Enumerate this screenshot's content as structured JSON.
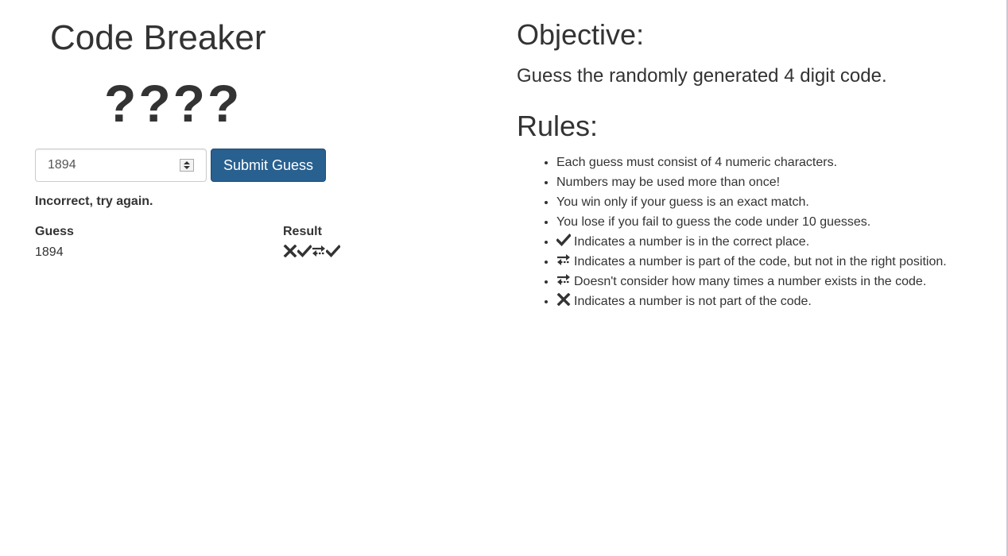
{
  "game": {
    "title": "Code Breaker",
    "code_display": "????",
    "guess_input": {
      "value": "1894"
    },
    "submit_label": "Submit Guess",
    "status_message": "Incorrect, try again.",
    "history": {
      "headers": {
        "guess": "Guess",
        "result": "Result"
      },
      "rows": [
        {
          "guess": "1894",
          "result": [
            "x-icon",
            "check-icon",
            "swap-icon",
            "check-icon"
          ]
        }
      ]
    }
  },
  "info": {
    "objective_heading": "Objective:",
    "objective_text": "Guess the randomly generated 4 digit code.",
    "rules_heading": "Rules:",
    "rules": [
      {
        "icon": "",
        "text": "Each guess must consist of 4 numeric characters."
      },
      {
        "icon": "",
        "text": "Numbers may be used more than once!"
      },
      {
        "icon": "",
        "text": "You win only if your guess is an exact match."
      },
      {
        "icon": "",
        "text": "You lose if you fail to guess the code under 10 guesses."
      },
      {
        "icon": "check-icon",
        "text": "Indicates a number is in the correct place."
      },
      {
        "icon": "swap-icon",
        "text": "Indicates a number is part of the code, but not in the right position."
      },
      {
        "icon": "swap-icon",
        "text": "Doesn't consider how many times a number exists in the code."
      },
      {
        "icon": "x-icon",
        "text": "Indicates a number is not part of the code."
      }
    ]
  },
  "colors": {
    "text": "#333333",
    "primary_button": "#286090",
    "primary_button_border": "#204d74",
    "input_border": "#cccccc"
  }
}
